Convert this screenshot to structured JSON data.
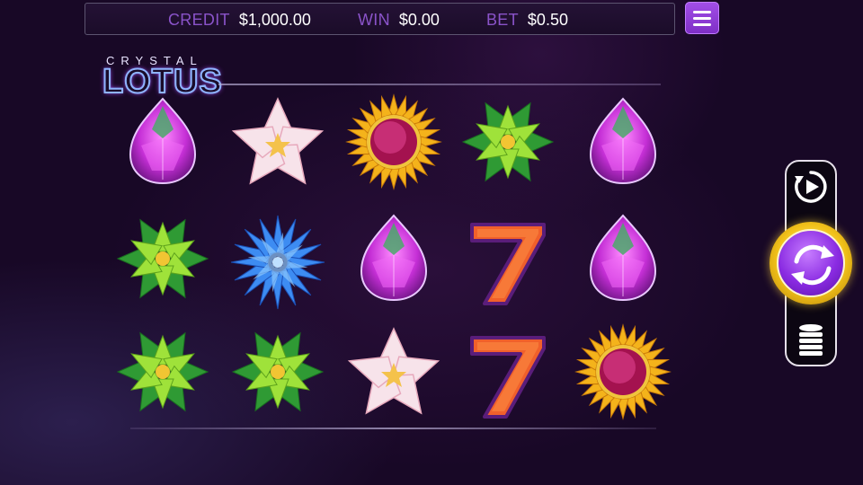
{
  "header": {
    "credit_label": "CREDIT",
    "credit_value": "$1,000.00",
    "win_label": "WIN",
    "win_value": "$0.00",
    "bet_label": "BET",
    "bet_value": "$0.50"
  },
  "logo": {
    "top": "CRYSTAL",
    "main": "LOTUS"
  },
  "reels": [
    [
      "pink-gem",
      "green-star-flower",
      "green-star-flower"
    ],
    [
      "white-lotus",
      "blue-spiky-flower",
      "green-star-flower"
    ],
    [
      "sunflower",
      "pink-gem",
      "white-lotus"
    ],
    [
      "green-star-flower",
      "seven",
      "seven"
    ],
    [
      "pink-gem",
      "pink-gem",
      "sunflower"
    ]
  ],
  "controls": {
    "menu_icon": "hamburger-icon",
    "autoplay_icon": "autoplay-icon",
    "spin_icon": "spin-icon",
    "bet_icon": "coin-stack-icon"
  },
  "colors": {
    "accent": "#8a53c9",
    "spin_gold": "#f2c21a",
    "spin_purple": "#8a2be2"
  }
}
